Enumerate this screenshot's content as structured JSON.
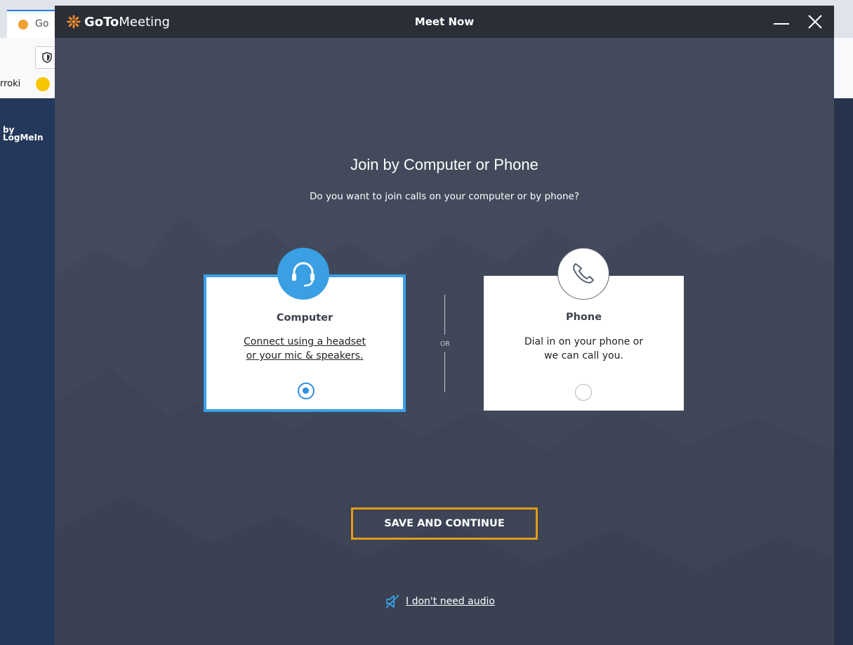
{
  "browser": {
    "tab_label": "Go",
    "bookmark_label": "rroki",
    "site_logo_line1": "by",
    "site_logo_line2": "LogMeIn"
  },
  "window": {
    "app_name_bold": "GoTo",
    "app_name_rest": "Meeting",
    "title": "Meet Now",
    "minimize_label": "Minimize",
    "close_label": "Close"
  },
  "dialog": {
    "heading": "Join by Computer or Phone",
    "subheading": "Do you want to join calls on your computer or by phone?",
    "or_label": "OR",
    "options": [
      {
        "title": "Computer",
        "desc_line1": "Connect using a headset",
        "desc_line2": "or your mic & speakers.",
        "selected": true,
        "icon": "headset-icon"
      },
      {
        "title": "Phone",
        "desc_line1": "Dial in on your phone or",
        "desc_line2": "we can call you.",
        "selected": false,
        "icon": "phone-icon"
      }
    ],
    "save_button": "SAVE AND CONTINUE",
    "no_audio_link": "I don't need audio"
  },
  "colors": {
    "accent_blue": "#3a9fe3",
    "save_border_orange": "#e59a1a",
    "window_bg": "#424a5b",
    "titlebar_bg": "#2a2e36"
  }
}
